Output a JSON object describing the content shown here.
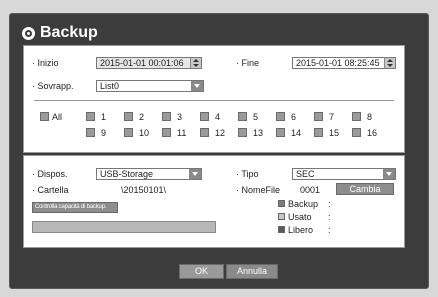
{
  "title": "Backup",
  "range": {
    "start_label": "· Inizio",
    "start_value": "2015-01-01 00:01:06",
    "end_label": "· Fine",
    "end_value": "2015-01-01 08:25:45",
    "overlap_label": "· Sovrapp.",
    "overlap_value": "List0"
  },
  "channels": {
    "all_label": "All",
    "items": [
      "1",
      "2",
      "3",
      "4",
      "5",
      "6",
      "7",
      "8",
      "9",
      "10",
      "11",
      "12",
      "13",
      "14",
      "15",
      "16"
    ]
  },
  "device": {
    "device_label": "· Dispos.",
    "device_value": "USB-Storage",
    "type_label": "· Tipo",
    "type_value": "SEC",
    "folder_label": "· Cartella",
    "folder_value": "\\20150101\\",
    "filename_label": "· NomeFile",
    "filename_value": "0001",
    "change_button": "Cambia",
    "check_capacity_button": "Controlla capacità di backup.",
    "legend_backup": "Backup",
    "legend_used": "Usato",
    "legend_free": "Libero",
    "legend_colon": ":"
  },
  "footer": {
    "ok": "OK",
    "cancel": "Annulla"
  }
}
